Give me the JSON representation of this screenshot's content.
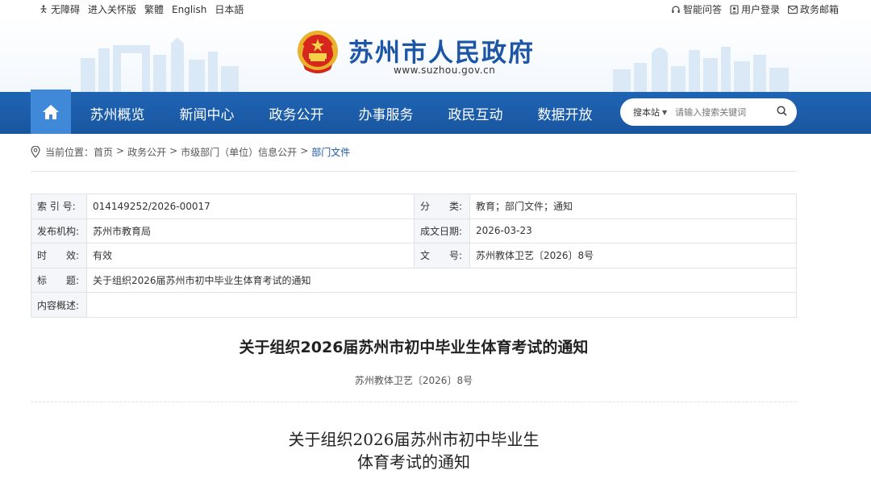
{
  "topbar": {
    "left": [
      {
        "label": "无障碍",
        "icon": "accessibility-icon"
      },
      {
        "label": "进入关怀版"
      },
      {
        "label": "繁體"
      },
      {
        "label": "English"
      },
      {
        "label": "日本語"
      }
    ],
    "right": [
      {
        "label": "智能问答",
        "icon": "headset-icon"
      },
      {
        "label": "用户登录",
        "icon": "user-icon"
      },
      {
        "label": "政务邮箱",
        "icon": "mail-icon"
      }
    ]
  },
  "header": {
    "title": "苏州市人民政府",
    "url": "www.suzhou.gov.cn"
  },
  "nav": {
    "items": [
      "苏州概览",
      "新闻中心",
      "政务公开",
      "办事服务",
      "政民互动",
      "数据开放"
    ],
    "search_scope": "搜本站",
    "search_placeholder": "请输入搜索关键词"
  },
  "breadcrumb": {
    "prefix": "当前位置：",
    "items": [
      "首页",
      "政务公开",
      "市级部门（单位）信息公开",
      "部门文件"
    ]
  },
  "meta": {
    "index_label": "索 引 号:",
    "index_value": "014149252/2026-00017",
    "category_label": "分　　类:",
    "category_value": "教育；部门文件；通知",
    "publisher_label": "发布机构:",
    "publisher_value": "苏州市教育局",
    "date_label": "成文日期:",
    "date_value": "2026-03-23",
    "validity_label": "时　　效:",
    "validity_value": "有效",
    "docno_label": "文　　号:",
    "docno_value": "苏州教体卫艺〔2026〕8号",
    "title_label": "标　　题:",
    "title_value": "关于组织2026届苏州市初中毕业生体育考试的通知",
    "summary_label": "内容概述:",
    "summary_value": ""
  },
  "article": {
    "title": "关于组织2026届苏州市初中毕业生体育考试的通知",
    "doc_no": "苏州教体卫艺〔2026〕8号",
    "body_title_line1": "关于组织2026届苏州市初中毕业生",
    "body_title_line2": "体育考试的通知"
  },
  "colors": {
    "nav_bg": "#1f64b3",
    "home_bg": "#3f89d8",
    "title_blue": "#1d56a6"
  }
}
